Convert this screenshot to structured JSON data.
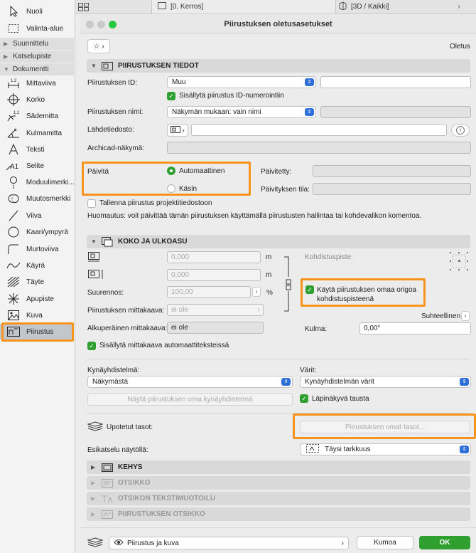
{
  "toolbox": {
    "items": [
      {
        "label": "Nuoli",
        "icon": "arrow-pointer-icon"
      },
      {
        "label": "Valinta-alue",
        "icon": "marquee-icon"
      }
    ],
    "groups": [
      {
        "label": "Suunnittelu"
      },
      {
        "label": "Katselupiste"
      },
      {
        "label": "Dokumentti"
      }
    ],
    "doc_items": [
      {
        "label": "Mittaviiva",
        "icon": "dimension-icon"
      },
      {
        "label": "Korko",
        "icon": "level-dimension-icon"
      },
      {
        "label": "Säde​mitta",
        "icon": "radial-dimension-icon"
      },
      {
        "label": "Kulmamitta",
        "icon": "angle-dimension-icon"
      },
      {
        "label": "Teksti",
        "icon": "text-icon"
      },
      {
        "label": "Selite",
        "icon": "label-icon"
      },
      {
        "label": "Moduulimerki...",
        "icon": "grid-marker-icon"
      },
      {
        "label": "Muutosmerkki",
        "icon": "change-marker-icon"
      },
      {
        "label": "Viiva",
        "icon": "line-icon"
      },
      {
        "label": "Kaari/ympyrä",
        "icon": "circle-icon"
      },
      {
        "label": "Murtoviiva",
        "icon": "polyline-icon"
      },
      {
        "label": "Käyrä",
        "icon": "spline-icon"
      },
      {
        "label": "Täyte",
        "icon": "fill-icon"
      },
      {
        "label": "Apupiste",
        "icon": "hotspot-icon"
      },
      {
        "label": "Kuva",
        "icon": "figure-icon"
      },
      {
        "label": "Piirustus",
        "icon": "drawing-icon"
      }
    ]
  },
  "tabs": [
    {
      "label": "[0. Kerros]"
    },
    {
      "label": "[3D / Kaikki]"
    }
  ],
  "dialog": {
    "title": "Piirustuksen oletusasetukset",
    "favorites_label": "Oletus",
    "sections": {
      "tiedot": "PIIRUSTUKSEN TIEDOT",
      "koko": "KOKO JA ULKOASU",
      "kehys": "KEHYS",
      "otsikko": "OTSIKKO",
      "tekstimuotoilu": "OTSIKON TEKSTIMUOTOILU",
      "piirustuksen_otsikko": "PIIRUSTUKSEN OTSIKKO"
    },
    "id_label": "Piirustuksen ID:",
    "id_value": "Muu",
    "include_id": "Sisällytä piirustus ID-numerointiin",
    "name_label": "Piirustuksen nimi:",
    "name_value": "Näkymän mukaan: vain nimi",
    "source_label": "Lähdetiedosto:",
    "view_label": "Archicad-näkymä:",
    "update_label": "Päivitä",
    "auto_label": "Automaattinen",
    "manual_label": "Käsin",
    "updated_label": "Päivitetty:",
    "update_status_label": "Päivityksen tila:",
    "save_in_project": "Tallenna piirustus projektitiedostoon",
    "note": "Huomautus: voit päivittää tämän piirustuksen käyttämällä piirustusten hallintaa tai kohdevalikon komentoa.",
    "width_value": "0,000",
    "height_value": "0,000",
    "unit_m": "m",
    "unit_pct": "%",
    "magnification_label": "Suurennos:",
    "magnification_value": "100,00",
    "scale_label": "Piirustuksen mittakaava:",
    "scale_value": "ei ole",
    "orig_scale_label": "Alkuperäinen mittakaava:",
    "orig_scale_value": "ei ole",
    "anchor_label": "Kohdistuspiste:",
    "use_origin": "Käytä piirustuksen omaa origoa kohdistuspisteenä",
    "relative_label": "Suhteellinen",
    "angle_label": "Kulma:",
    "angle_value": "0,00°",
    "include_scale": "Sisällytä mittakaava automaattiteksteissä",
    "pen_set_label": "Kynäyhdistelmä:",
    "pen_set_value": "Näkymästä",
    "show_pen_set_btn": "Näytä piirustuksen oma kynäyhdistelmä",
    "colors_label": "Värit:",
    "colors_value": "Kynäyhdistelmän värit",
    "transparent_bg": "Läpinäkyvä tausta",
    "nested_layers_label": "Upotetut tasot:",
    "own_layers_btn": "Piirustuksen omat tasot...",
    "preview_label": "Esikatselu näytöllä:",
    "preview_value": "Täysi tarkkuus",
    "footer_mode": "Piirustus ja kuva",
    "cancel": "Kumoa",
    "ok": "OK"
  },
  "colors": {
    "accent": "#2fa02f",
    "highlight": "#f7941d",
    "popup": "#2f6fd8"
  }
}
